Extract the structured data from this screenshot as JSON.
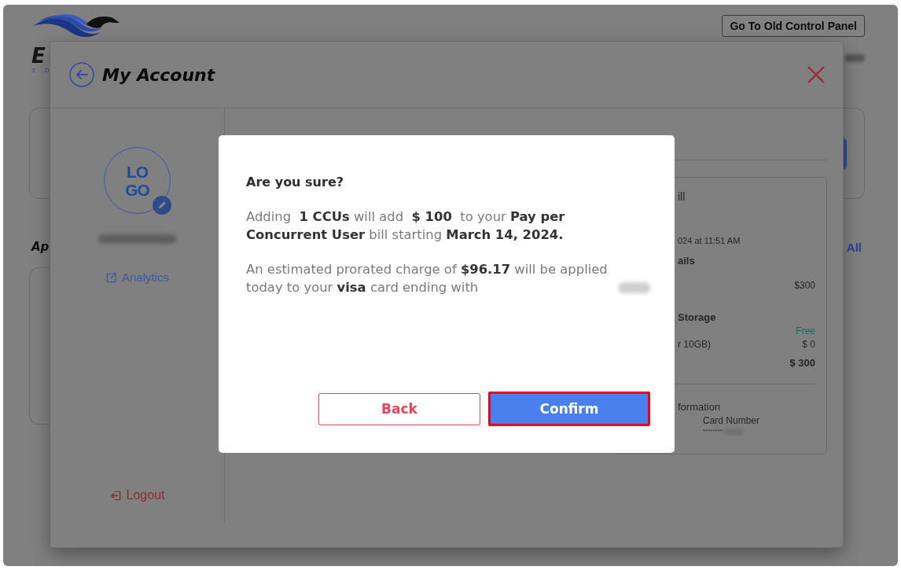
{
  "page": {
    "header": {
      "logo_text": "E",
      "logo_tagline": "3 D",
      "old_panel_button": "Go To Old Control Panel"
    },
    "section": {
      "heading": "Ap",
      "view_all_link": "All"
    }
  },
  "account_modal": {
    "title": "My Account",
    "avatar_logo_lines": [
      "LO",
      "GO"
    ],
    "analytics_link": "Analytics",
    "logout_link": "Logout",
    "bill_card": {
      "title": "ill",
      "date": "024 at 11:51 AM",
      "details_heading": "ails",
      "ccu_price": "$300",
      "storage_heading": "Storage",
      "storage_badge": "Free",
      "storage_label": "r 10GB)",
      "storage_price": "$ 0",
      "total": "$ 300",
      "payment_heading": "formation",
      "card_number_label": "Card Number",
      "card_number_mask": "********"
    }
  },
  "confirm_dialog": {
    "title": "Are you sure?",
    "paragraphs": [
      {
        "text": "Adding  **1 CCUs** will add  **$ 100**  to your **Pay per Concurrent User** bill starting **March 14, 2024.**",
        "redacted_suffix": false
      },
      {
        "text": "An estimated prorated charge of **$96.17** will be applied today to your **visa** card ending with",
        "redacted_suffix": true
      }
    ],
    "buttons": [
      {
        "label": "Back",
        "kind": "secondary",
        "highlighted": false
      },
      {
        "label": "Confirm",
        "kind": "primary",
        "highlighted": true
      }
    ]
  }
}
